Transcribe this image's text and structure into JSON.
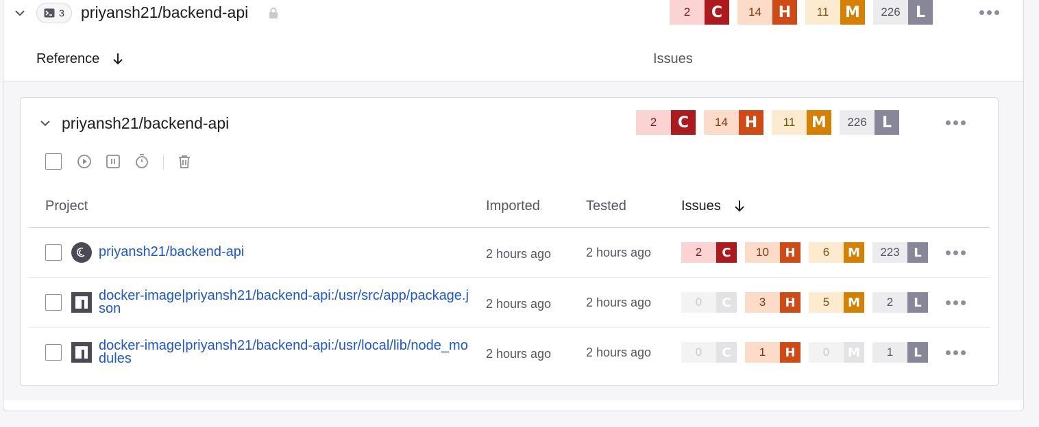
{
  "org": {
    "name": "priyansh21/backend-api",
    "target_count": "3",
    "issues": [
      {
        "count": "2",
        "letter": "C"
      },
      {
        "count": "14",
        "letter": "H"
      },
      {
        "count": "11",
        "letter": "M"
      },
      {
        "count": "226",
        "letter": "L"
      }
    ],
    "columns": {
      "reference": "Reference",
      "issues": "Issues"
    }
  },
  "target": {
    "name": "priyansh21/backend-api",
    "issues": [
      {
        "count": "2",
        "letter": "C"
      },
      {
        "count": "14",
        "letter": "H"
      },
      {
        "count": "11",
        "letter": "M"
      },
      {
        "count": "226",
        "letter": "L"
      }
    ],
    "columns": {
      "project": "Project",
      "imported": "Imported",
      "tested": "Tested",
      "issues": "Issues"
    },
    "projects": [
      {
        "name": "priyansh21/backend-api",
        "icon": "debian-icon",
        "imported": "2 hours ago",
        "tested": "2 hours ago",
        "issues": [
          {
            "count": "2",
            "letter": "C"
          },
          {
            "count": "10",
            "letter": "H"
          },
          {
            "count": "6",
            "letter": "M"
          },
          {
            "count": "223",
            "letter": "L"
          }
        ]
      },
      {
        "name_line1": "docker-image|priyansh21/backend-api:/usr/src/app/package.j",
        "name_line2": "son",
        "icon": "npm-icon",
        "imported": "2 hours ago",
        "tested": "2 hours ago",
        "issues": [
          {
            "count": "0",
            "letter": "C"
          },
          {
            "count": "3",
            "letter": "H"
          },
          {
            "count": "5",
            "letter": "M"
          },
          {
            "count": "2",
            "letter": "L"
          }
        ]
      },
      {
        "name_line1": "docker-image|priyansh21/backend-api:/usr/local/lib/node_mo",
        "name_line2": "dules",
        "icon": "npm-icon",
        "imported": "2 hours ago",
        "tested": "2 hours ago",
        "issues": [
          {
            "count": "0",
            "letter": "C"
          },
          {
            "count": "1",
            "letter": "H"
          },
          {
            "count": "0",
            "letter": "M"
          },
          {
            "count": "1",
            "letter": "L"
          }
        ]
      }
    ]
  },
  "colors": {
    "critical": "#ac1a1e",
    "critical_bg": "#fbd3d3",
    "high": "#cf4a14",
    "high_bg": "#fcdcc9",
    "medium": "#d68000",
    "medium_bg": "#fdebcf",
    "low": "#88879a",
    "low_bg": "#ececef",
    "zero_bg": "#f3f3f4",
    "zero_let": "#e3e3e6",
    "link": "#1a56d6"
  }
}
